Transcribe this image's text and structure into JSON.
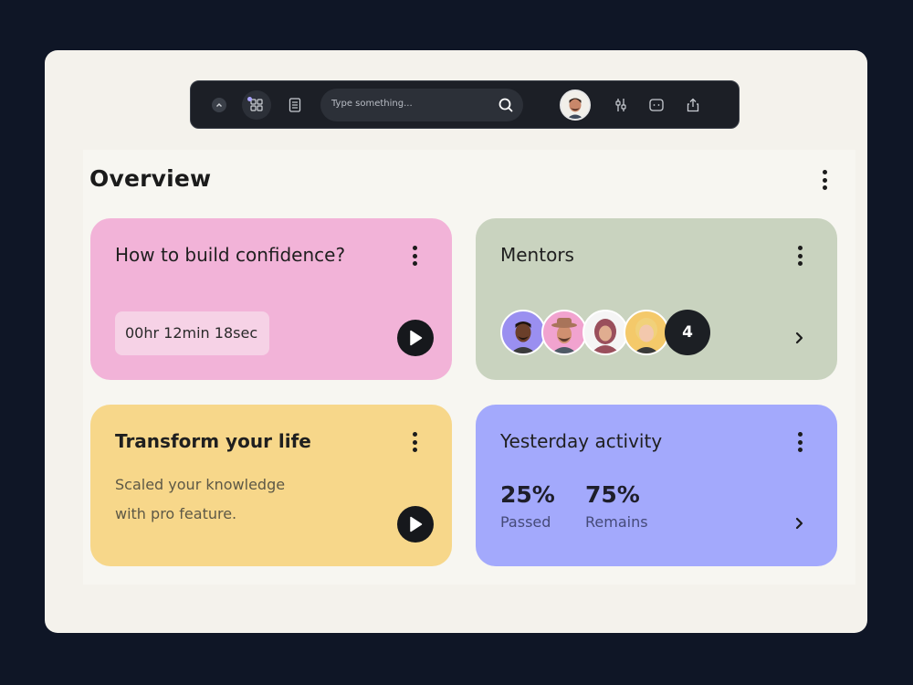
{
  "toolbar": {
    "search_placeholder": "Type something...",
    "icons": [
      "chevron-up-icon",
      "grid-icon",
      "document-icon",
      "search-icon",
      "sliders-icon",
      "message-icon",
      "share-icon"
    ]
  },
  "overview": {
    "title": "Overview"
  },
  "cards": {
    "confidence": {
      "title": "How to build confidence?",
      "timer": "00hr 12min 18sec",
      "color": "#f2b3d8"
    },
    "mentors": {
      "title": "Mentors",
      "extra_count": "4",
      "color": "#c9d3bf"
    },
    "transform": {
      "title": "Transform your life",
      "description_line1": "Scaled your knowledge",
      "description_line2": "with pro feature.",
      "color": "#f7d78a"
    },
    "activity": {
      "title": "Yesterday activity",
      "stats": [
        {
          "value": "25%",
          "label": "Passed"
        },
        {
          "value": "75%",
          "label": "Remains"
        }
      ],
      "color": "#a3a9fc"
    }
  },
  "colors": {
    "background": "#0f1626",
    "frame": "#f4f2ec",
    "toolbar": "#1c1f26",
    "accent": "#a9a3ff"
  }
}
